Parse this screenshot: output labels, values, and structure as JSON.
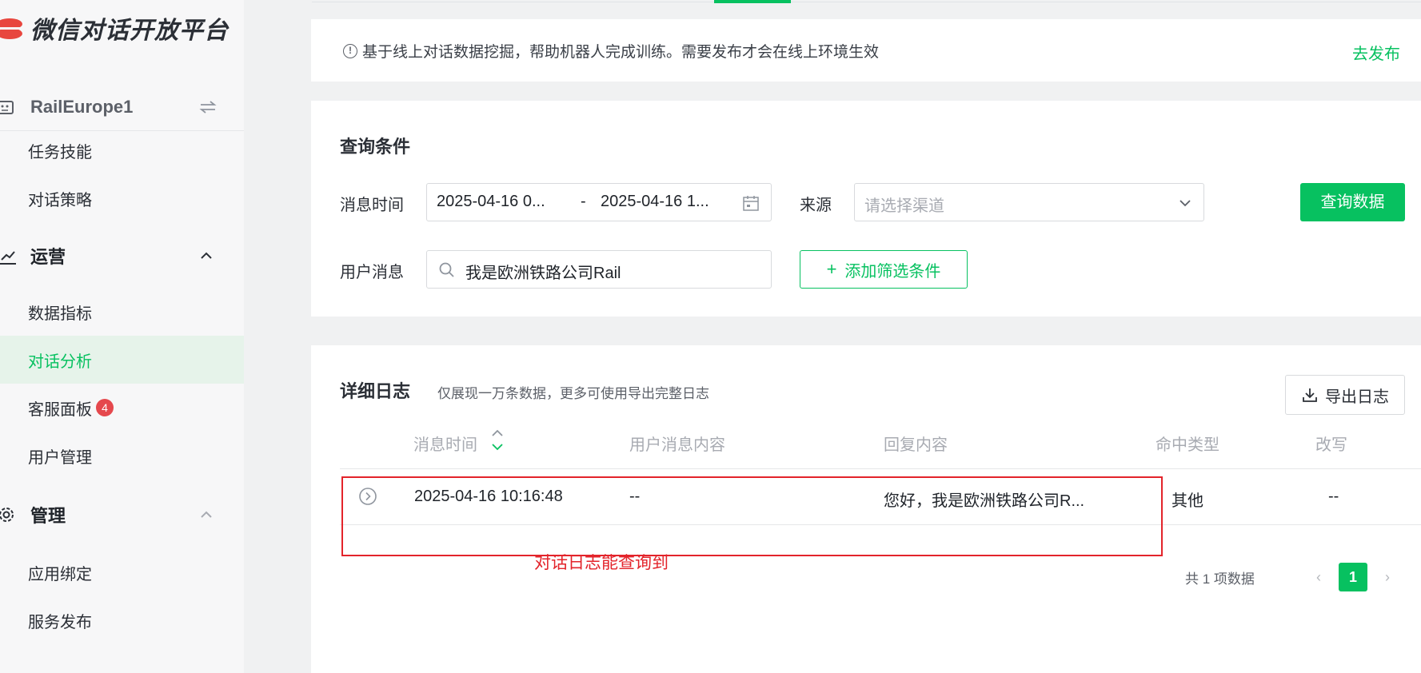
{
  "app": {
    "title": "微信对话开放平台",
    "brand_color": "#07c160",
    "logo_color": "#e8463e"
  },
  "bot": {
    "name": "RailEurope1"
  },
  "sidebar": {
    "items_top": [
      {
        "label": "任务技能"
      },
      {
        "label": "对话策略"
      }
    ],
    "ops_group": {
      "label": "运营",
      "icon": "trend-chart-icon"
    },
    "ops_items": [
      {
        "label": "数据指标"
      },
      {
        "label": "对话分析",
        "active": true
      },
      {
        "label": "客服面板",
        "badge": "4"
      },
      {
        "label": "用户管理"
      }
    ],
    "manage_group": {
      "label": "管理",
      "icon": "gear-icon"
    },
    "manage_items": [
      {
        "label": "应用绑定"
      },
      {
        "label": "服务发布"
      }
    ]
  },
  "notice": {
    "text": "基于线上对话数据挖掘，帮助机器人完成训练。需要发布才会在线上环境生效",
    "action": "去发布"
  },
  "query": {
    "title": "查询条件",
    "time_label": "消息时间",
    "date_start": "2025-04-16 0...",
    "date_sep": "-",
    "date_end": "2025-04-16 1...",
    "source_label": "来源",
    "source_placeholder": "请选择渠道",
    "query_button": "查询数据",
    "user_msg_label": "用户消息",
    "user_msg_value": "我是欧洲铁路公司Rail",
    "add_filter": "添加筛选条件"
  },
  "log": {
    "title": "详细日志",
    "subtitle": "仅展现一万条数据，更多可使用导出完整日志",
    "export_button": "导出日志",
    "columns": [
      "消息时间",
      "用户消息内容",
      "回复内容",
      "命中类型",
      "改写"
    ],
    "rows": [
      {
        "time": "2025-04-16 10:16:48",
        "user_msg": "--",
        "reply": "您好，我是欧洲铁路公司R...",
        "hit_type": "其他",
        "rewrite": "--"
      }
    ],
    "annotation": "对话日志能查询到",
    "pager": {
      "total": "共 1 项数据",
      "prev": "‹",
      "current": "1",
      "next": "›"
    }
  }
}
